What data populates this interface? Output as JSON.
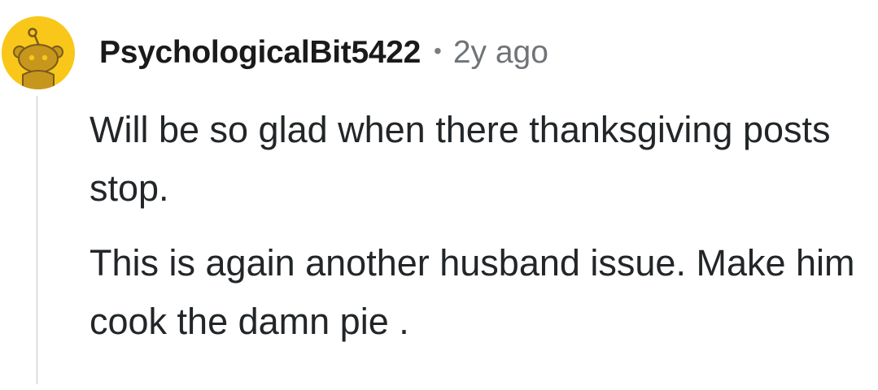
{
  "comment": {
    "avatar_icon": "reddit-snoo-avatar-icon",
    "avatar_color": "#f8c719",
    "username": "PsychologicalBit5422",
    "separator": "•",
    "timestamp": "2y ago",
    "paragraphs": [
      "Will be so glad when there thanksgiving posts stop.",
      "This is again another husband issue. Make him cook the damn pie ."
    ]
  }
}
